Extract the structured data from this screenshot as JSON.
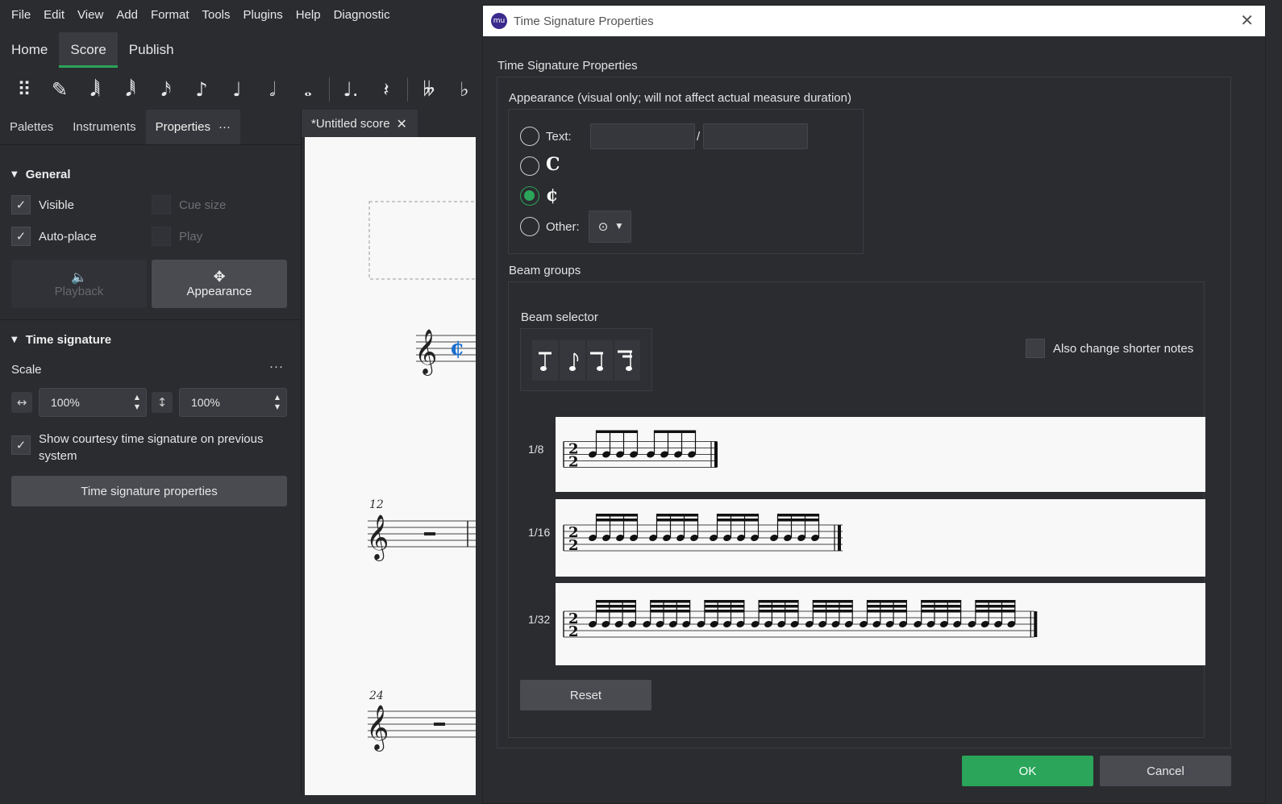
{
  "menu": [
    "File",
    "Edit",
    "View",
    "Add",
    "Format",
    "Tools",
    "Plugins",
    "Help",
    "Diagnostic"
  ],
  "workspace_tabs": [
    {
      "label": "Home",
      "active": false
    },
    {
      "label": "Score",
      "active": true
    },
    {
      "label": "Publish",
      "active": false
    }
  ],
  "toolbar_icons": [
    "palette-grip-icon",
    "note-input-pen-icon",
    "64th-note-icon",
    "32nd-note-icon",
    "16th-note-icon",
    "eighth-note-icon",
    "quarter-note-icon",
    "half-note-icon",
    "whole-note-icon",
    "augmentation-dot-icon",
    "rest-icon",
    "double-flat-icon",
    "flat-icon"
  ],
  "panel": {
    "tabs": [
      "Palettes",
      "Instruments",
      "Properties"
    ],
    "active_tab": "Properties",
    "more": "···",
    "general": {
      "title": "General",
      "visible": "Visible",
      "cue_size": "Cue size",
      "auto_place": "Auto-place",
      "play": "Play",
      "playback": "Playback",
      "appearance": "Appearance"
    },
    "time_signature": {
      "title": "Time signature",
      "scale": "Scale",
      "scale_more": "···",
      "horizontal": "100%",
      "vertical": "100%",
      "courtesy": "Show courtesy time signature on previous system",
      "properties_button": "Time signature properties"
    }
  },
  "score": {
    "tab_title": "*Untitled score",
    "measure_12": "12",
    "measure_24": "24"
  },
  "dialog": {
    "window_title": "Time Signature Properties",
    "logo": "mu",
    "heading": "Time Signature Properties",
    "appearance_label": "Appearance (visual only; will not affect actual measure duration)",
    "text_option": "Text:",
    "slash": "/",
    "other_option": "Other:",
    "selected_option": "cut-time",
    "beam_groups": "Beam groups",
    "beam_selector": "Beam selector",
    "also_change": "Also change shorter notes",
    "rows": [
      {
        "label": "1/8",
        "groups": 2,
        "per_group": 4,
        "beams": 1
      },
      {
        "label": "1/16",
        "groups": 4,
        "per_group": 4,
        "beams": 2
      },
      {
        "label": "1/32",
        "groups": 8,
        "per_group": 4,
        "beams": 3
      }
    ],
    "time_signature": {
      "numerator": "2",
      "denominator": "2"
    },
    "reset": "Reset",
    "ok": "OK",
    "cancel": "Cancel"
  },
  "colors": {
    "accent": "#2aa55a",
    "score_timesig": "#1a6fd1"
  }
}
